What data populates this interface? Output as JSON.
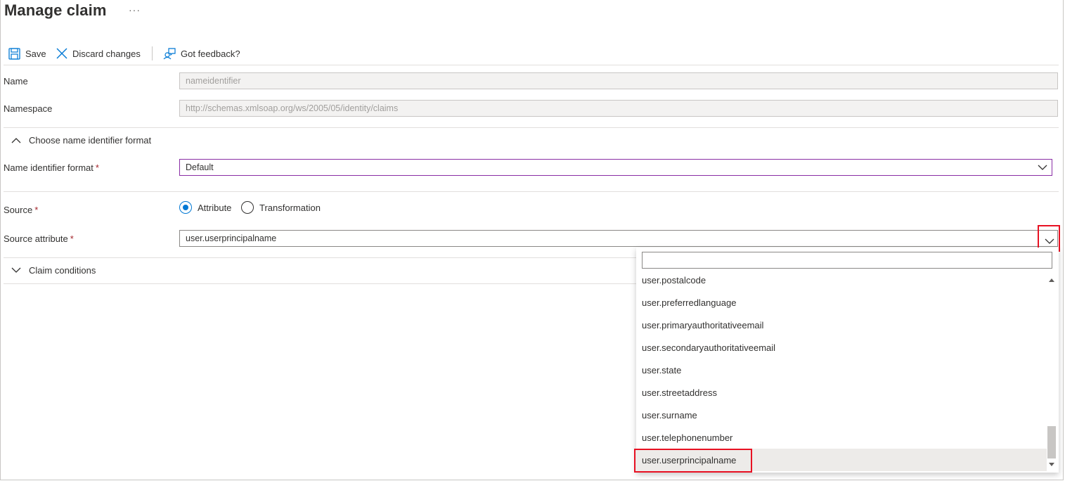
{
  "header": {
    "title": "Manage claim",
    "more_label": "···"
  },
  "toolbar": {
    "save_label": "Save",
    "discard_label": "Discard changes",
    "feedback_label": "Got feedback?"
  },
  "form": {
    "name": {
      "label": "Name",
      "value": "nameidentifier"
    },
    "namespace": {
      "label": "Namespace",
      "value": "http://schemas.xmlsoap.org/ws/2005/05/identity/claims"
    },
    "name_id_section": {
      "label": "Choose name identifier format",
      "expanded": true
    },
    "name_id_format": {
      "label": "Name identifier format",
      "required_mark": "*",
      "value": "Default"
    },
    "source": {
      "label": "Source",
      "required_mark": "*",
      "options": [
        "Attribute",
        "Transformation"
      ],
      "selected": "Attribute"
    },
    "source_attribute": {
      "label": "Source attribute",
      "required_mark": "*",
      "value": "user.userprincipalname"
    },
    "claim_conditions": {
      "label": "Claim conditions",
      "expanded": false
    }
  },
  "dropdown": {
    "search_value": "",
    "items": [
      "user.postalcode",
      "user.preferredlanguage",
      "user.primaryauthoritativeemail",
      "user.secondaryauthoritativeemail",
      "user.state",
      "user.streetaddress",
      "user.surname",
      "user.telephonenumber",
      "user.userprincipalname"
    ],
    "selected": "user.userprincipalname"
  },
  "colors": {
    "accent": "#0078d4",
    "highlight": "#e81123",
    "focus_border": "#8a2da5"
  }
}
